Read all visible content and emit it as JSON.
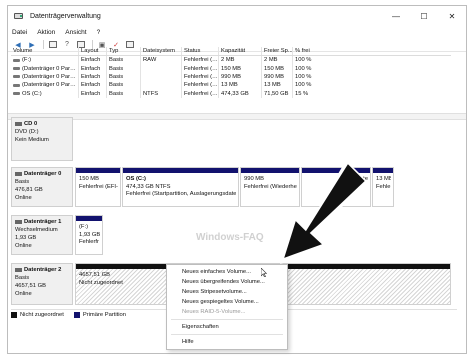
{
  "window": {
    "title": "Datenträgerverwaltung",
    "controls": [
      "—",
      "☐",
      "✕"
    ]
  },
  "menu": [
    "Datei",
    "Aktion",
    "Ansicht",
    "?"
  ],
  "toolbar": [
    "back-icon",
    "forward-icon",
    "properties-icon",
    "help-icon",
    "refresh-icon",
    "disk-icon",
    "check-icon",
    "rescan-icon"
  ],
  "volume_table": {
    "headers": [
      "Volume",
      "Layout",
      "Typ",
      "Dateisystem",
      "Status",
      "Kapazität",
      "Freier Sp...",
      "% frei"
    ],
    "rows": [
      [
        "(F:)",
        "Einfach",
        "Basis",
        "RAW",
        "Fehlerfrei (…",
        "2 MB",
        "2 MB",
        "100 %"
      ],
      [
        "(Datenträger 0 Par…",
        "Einfach",
        "Basis",
        "",
        "Fehlerfrei (…",
        "150 MB",
        "150 MB",
        "100 %"
      ],
      [
        "(Datenträger 0 Par…",
        "Einfach",
        "Basis",
        "",
        "Fehlerfrei (…",
        "990 MB",
        "990 MB",
        "100 %"
      ],
      [
        "(Datenträger 0 Par…",
        "Einfach",
        "Basis",
        "",
        "Fehlerfrei (…",
        "13 MB",
        "13 MB",
        "100 %"
      ],
      [
        "OS (C:)",
        "Einfach",
        "Basis",
        "NTFS",
        "Fehlerfrei (…",
        "474,33 GB",
        "71,50 GB",
        "15 %"
      ]
    ]
  },
  "disks": [
    {
      "name": "CD 0",
      "lines": [
        "DVD (D:)",
        "",
        "Kein Medium"
      ],
      "partitions": []
    },
    {
      "name": "Datenträger 0",
      "lines": [
        "Basis",
        "476,81 GB",
        "Online"
      ],
      "partitions": [
        {
          "lines": [
            "",
            "150 MB",
            "Fehlerfrei (EFI-S"
          ]
        },
        {
          "lines": [
            "OS  (C:)",
            "474,33 GB NTFS",
            "Fehlerfrei (Startpartition, Auslagerungsdatei,"
          ]
        },
        {
          "lines": [
            "",
            "990 MB",
            "Fehlerfrei (Wiederhe"
          ]
        },
        {
          "lines": [
            "",
            "",
            "herste"
          ]
        },
        {
          "lines": [
            "",
            "13 MB",
            "Fehle"
          ]
        }
      ]
    },
    {
      "name": "Datenträger 1",
      "lines": [
        "Wechselmedium",
        "1,93 GB",
        "Online"
      ],
      "partitions": [
        {
          "lines": [
            "(F:)",
            "1,93 GB R",
            "Fehlerfr"
          ]
        }
      ]
    },
    {
      "name": "Datenträger 2",
      "lines": [
        "Basis",
        "4657,51 GB",
        "Online"
      ],
      "partitions": [
        {
          "lines": [
            "4657,51 GB",
            "Nicht zugeordnet"
          ]
        }
      ]
    }
  ],
  "legend": [
    {
      "label": "Nicht zugeordnet",
      "color": "#111111"
    },
    {
      "label": "Primäre Partition",
      "color": "#12126e"
    }
  ],
  "context_menu": {
    "items": [
      {
        "label": "Neues einfaches Volume...",
        "enabled": true
      },
      {
        "label": "Neues übergreifendes Volume...",
        "enabled": true
      },
      {
        "label": "Neues Stripesetvolume...",
        "enabled": true
      },
      {
        "label": "Neues gespiegeltes Volume...",
        "enabled": true
      },
      {
        "label": "Neues RAID-5-Volume...",
        "enabled": false
      },
      {
        "label": "Eigenschaften",
        "enabled": true
      },
      {
        "label": "Hilfe",
        "enabled": true
      }
    ]
  },
  "watermark": "Windows-FAQ",
  "colors": {
    "primary_partition": "#12126e",
    "unallocated": "#111111",
    "arrow": "#111111"
  }
}
